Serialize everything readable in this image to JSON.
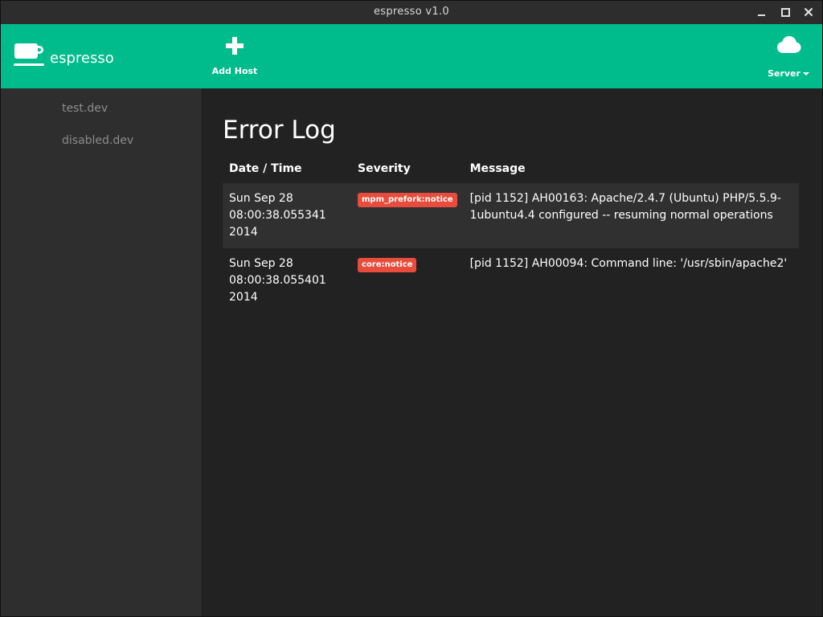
{
  "window": {
    "title": "espresso v1.0"
  },
  "brand": {
    "name": "espresso",
    "icon": "coffee-cup-icon"
  },
  "nav": {
    "add_host": {
      "label": "Add Host",
      "icon": "plus-icon"
    },
    "server": {
      "label": "Server",
      "icon": "cloud-icon"
    }
  },
  "sidebar": {
    "items": [
      {
        "label": "test.dev"
      },
      {
        "label": "disabled.dev"
      }
    ]
  },
  "main": {
    "title": "Error Log",
    "columns": [
      "Date / Time",
      "Severity",
      "Message"
    ],
    "rows": [
      {
        "date": "Sun Sep 28 08:00:38.055341 2014",
        "severity": "mpm_prefork:notice",
        "message": "[pid 1152] AH00163: Apache/2.4.7 (Ubuntu) PHP/5.5.9-1ubuntu4.4 configured -- resuming normal operations"
      },
      {
        "date": "Sun Sep 28 08:00:38.055401 2014",
        "severity": "core:notice",
        "message": "[pid 1152] AH00094: Command line: '/usr/sbin/apache2'"
      }
    ]
  },
  "colors": {
    "header": "#00bc8c",
    "sidebar": "#2e2e2e",
    "main": "#222222",
    "badge": "#e74c3c"
  }
}
